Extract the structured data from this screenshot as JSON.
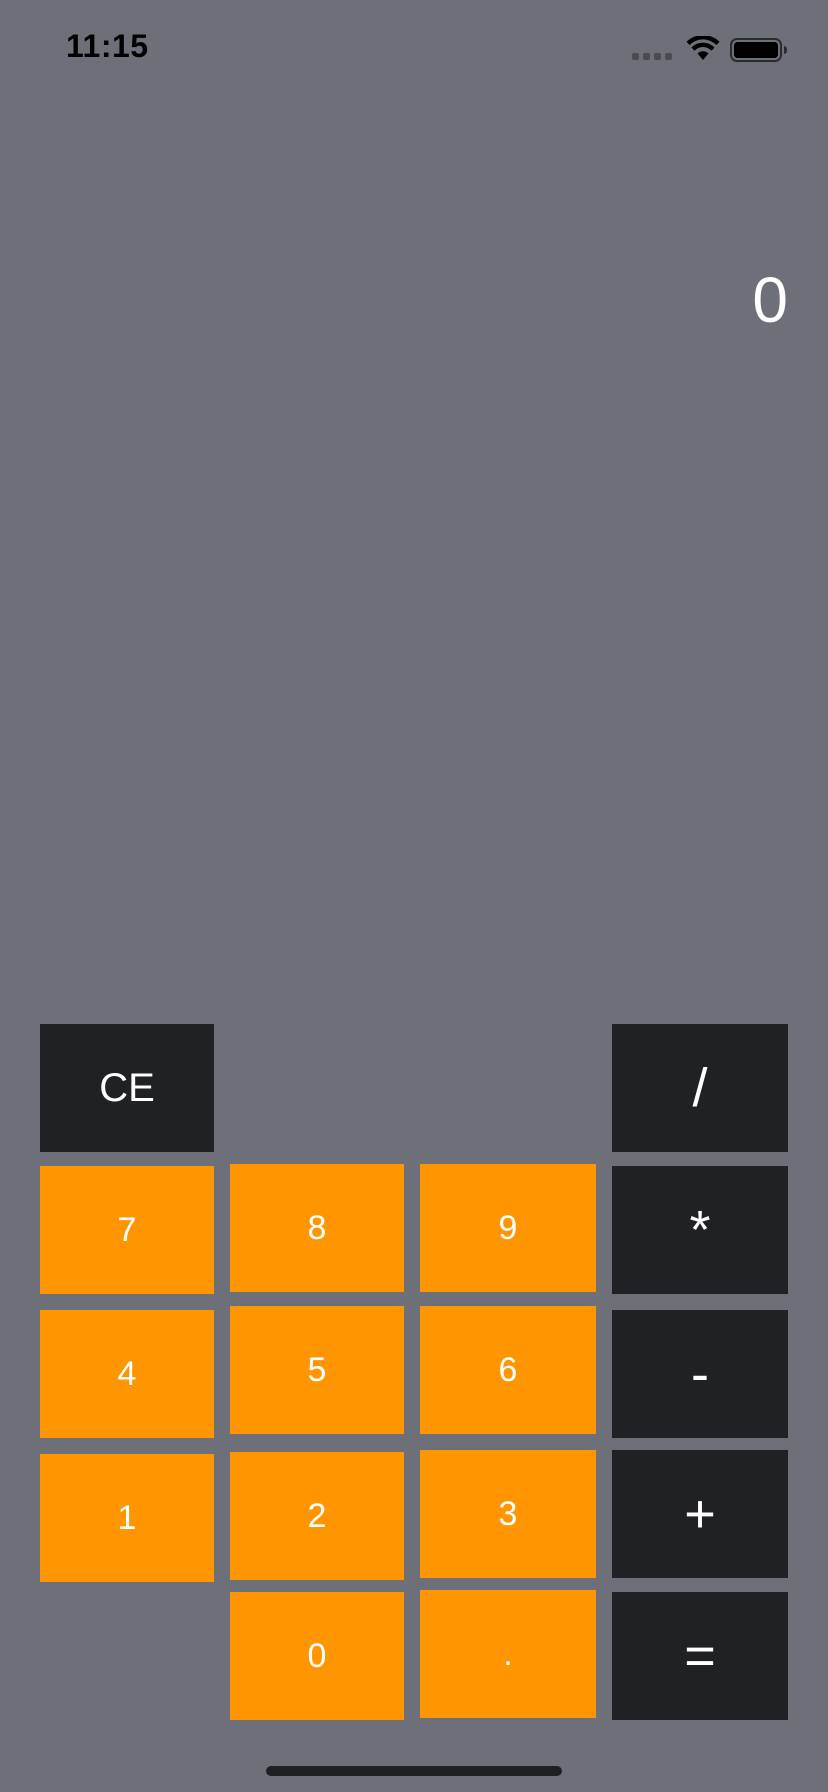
{
  "status_bar": {
    "time": "11:15",
    "signal_icon": "cellular-signal-icon",
    "wifi_icon": "wifi-icon",
    "battery_icon": "battery-icon",
    "battery_level": 0.9
  },
  "display": {
    "value": "0"
  },
  "keys": {
    "ce": "CE",
    "divide": "/",
    "multiply": "*",
    "subtract": "-",
    "add": "+",
    "equals": "=",
    "seven": "7",
    "eight": "8",
    "nine": "9",
    "four": "4",
    "five": "5",
    "six": "6",
    "one": "1",
    "two": "2",
    "three": "3",
    "zero": "0",
    "decimal": "."
  },
  "colors": {
    "background": "#6e7079",
    "digit_key": "#ff9500",
    "operator_key": "#202124",
    "key_text": "#ffffff"
  }
}
